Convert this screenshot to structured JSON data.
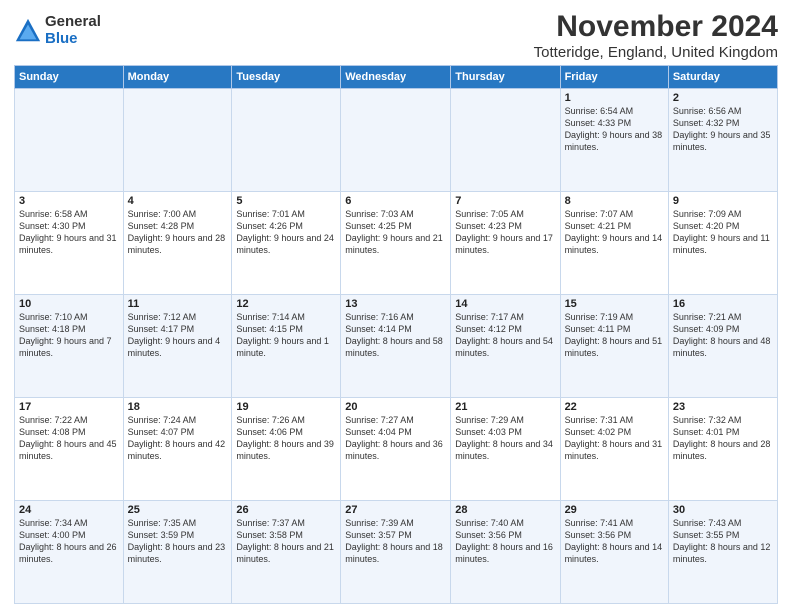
{
  "logo": {
    "general": "General",
    "blue": "Blue"
  },
  "title": "November 2024",
  "subtitle": "Totteridge, England, United Kingdom",
  "header": {
    "days": [
      "Sunday",
      "Monday",
      "Tuesday",
      "Wednesday",
      "Thursday",
      "Friday",
      "Saturday"
    ]
  },
  "weeks": [
    [
      {
        "num": "",
        "info": ""
      },
      {
        "num": "",
        "info": ""
      },
      {
        "num": "",
        "info": ""
      },
      {
        "num": "",
        "info": ""
      },
      {
        "num": "",
        "info": ""
      },
      {
        "num": "1",
        "info": "Sunrise: 6:54 AM\nSunset: 4:33 PM\nDaylight: 9 hours and 38 minutes."
      },
      {
        "num": "2",
        "info": "Sunrise: 6:56 AM\nSunset: 4:32 PM\nDaylight: 9 hours and 35 minutes."
      }
    ],
    [
      {
        "num": "3",
        "info": "Sunrise: 6:58 AM\nSunset: 4:30 PM\nDaylight: 9 hours and 31 minutes."
      },
      {
        "num": "4",
        "info": "Sunrise: 7:00 AM\nSunset: 4:28 PM\nDaylight: 9 hours and 28 minutes."
      },
      {
        "num": "5",
        "info": "Sunrise: 7:01 AM\nSunset: 4:26 PM\nDaylight: 9 hours and 24 minutes."
      },
      {
        "num": "6",
        "info": "Sunrise: 7:03 AM\nSunset: 4:25 PM\nDaylight: 9 hours and 21 minutes."
      },
      {
        "num": "7",
        "info": "Sunrise: 7:05 AM\nSunset: 4:23 PM\nDaylight: 9 hours and 17 minutes."
      },
      {
        "num": "8",
        "info": "Sunrise: 7:07 AM\nSunset: 4:21 PM\nDaylight: 9 hours and 14 minutes."
      },
      {
        "num": "9",
        "info": "Sunrise: 7:09 AM\nSunset: 4:20 PM\nDaylight: 9 hours and 11 minutes."
      }
    ],
    [
      {
        "num": "10",
        "info": "Sunrise: 7:10 AM\nSunset: 4:18 PM\nDaylight: 9 hours and 7 minutes."
      },
      {
        "num": "11",
        "info": "Sunrise: 7:12 AM\nSunset: 4:17 PM\nDaylight: 9 hours and 4 minutes."
      },
      {
        "num": "12",
        "info": "Sunrise: 7:14 AM\nSunset: 4:15 PM\nDaylight: 9 hours and 1 minute."
      },
      {
        "num": "13",
        "info": "Sunrise: 7:16 AM\nSunset: 4:14 PM\nDaylight: 8 hours and 58 minutes."
      },
      {
        "num": "14",
        "info": "Sunrise: 7:17 AM\nSunset: 4:12 PM\nDaylight: 8 hours and 54 minutes."
      },
      {
        "num": "15",
        "info": "Sunrise: 7:19 AM\nSunset: 4:11 PM\nDaylight: 8 hours and 51 minutes."
      },
      {
        "num": "16",
        "info": "Sunrise: 7:21 AM\nSunset: 4:09 PM\nDaylight: 8 hours and 48 minutes."
      }
    ],
    [
      {
        "num": "17",
        "info": "Sunrise: 7:22 AM\nSunset: 4:08 PM\nDaylight: 8 hours and 45 minutes."
      },
      {
        "num": "18",
        "info": "Sunrise: 7:24 AM\nSunset: 4:07 PM\nDaylight: 8 hours and 42 minutes."
      },
      {
        "num": "19",
        "info": "Sunrise: 7:26 AM\nSunset: 4:06 PM\nDaylight: 8 hours and 39 minutes."
      },
      {
        "num": "20",
        "info": "Sunrise: 7:27 AM\nSunset: 4:04 PM\nDaylight: 8 hours and 36 minutes."
      },
      {
        "num": "21",
        "info": "Sunrise: 7:29 AM\nSunset: 4:03 PM\nDaylight: 8 hours and 34 minutes."
      },
      {
        "num": "22",
        "info": "Sunrise: 7:31 AM\nSunset: 4:02 PM\nDaylight: 8 hours and 31 minutes."
      },
      {
        "num": "23",
        "info": "Sunrise: 7:32 AM\nSunset: 4:01 PM\nDaylight: 8 hours and 28 minutes."
      }
    ],
    [
      {
        "num": "24",
        "info": "Sunrise: 7:34 AM\nSunset: 4:00 PM\nDaylight: 8 hours and 26 minutes."
      },
      {
        "num": "25",
        "info": "Sunrise: 7:35 AM\nSunset: 3:59 PM\nDaylight: 8 hours and 23 minutes."
      },
      {
        "num": "26",
        "info": "Sunrise: 7:37 AM\nSunset: 3:58 PM\nDaylight: 8 hours and 21 minutes."
      },
      {
        "num": "27",
        "info": "Sunrise: 7:39 AM\nSunset: 3:57 PM\nDaylight: 8 hours and 18 minutes."
      },
      {
        "num": "28",
        "info": "Sunrise: 7:40 AM\nSunset: 3:56 PM\nDaylight: 8 hours and 16 minutes."
      },
      {
        "num": "29",
        "info": "Sunrise: 7:41 AM\nSunset: 3:56 PM\nDaylight: 8 hours and 14 minutes."
      },
      {
        "num": "30",
        "info": "Sunrise: 7:43 AM\nSunset: 3:55 PM\nDaylight: 8 hours and 12 minutes."
      }
    ]
  ]
}
